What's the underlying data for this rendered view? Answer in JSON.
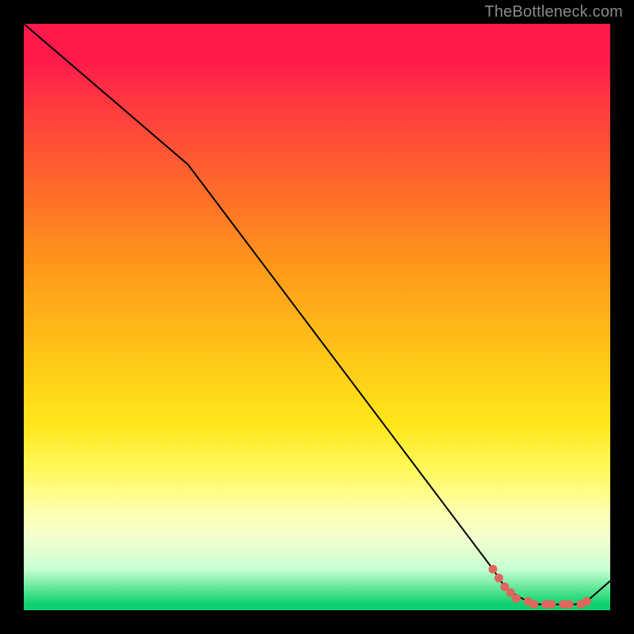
{
  "watermark": "TheBottleneck.com",
  "chart_data": {
    "type": "line",
    "title": "",
    "xlabel": "",
    "ylabel": "",
    "xlim": [
      0,
      100
    ],
    "ylim": [
      0,
      100
    ],
    "grid": false,
    "legend": false,
    "gradient_stops": [
      {
        "pct": 0,
        "color": "#ff1a4b"
      },
      {
        "pct": 6,
        "color": "#ff1a4b"
      },
      {
        "pct": 14,
        "color": "#ff3a3f"
      },
      {
        "pct": 28,
        "color": "#ff6a2a"
      },
      {
        "pct": 42,
        "color": "#ff9a1a"
      },
      {
        "pct": 56,
        "color": "#ffc418"
      },
      {
        "pct": 68,
        "color": "#ffe61a"
      },
      {
        "pct": 76,
        "color": "#fff95a"
      },
      {
        "pct": 83,
        "color": "#fdffad"
      },
      {
        "pct": 88,
        "color": "#f1ffd0"
      },
      {
        "pct": 93,
        "color": "#c8ffd4"
      },
      {
        "pct": 97,
        "color": "#49e28a"
      },
      {
        "pct": 99,
        "color": "#0fd071"
      },
      {
        "pct": 100,
        "color": "#0fd071"
      }
    ],
    "series": [
      {
        "name": "bottleneck-curve",
        "color": "#000000",
        "x": [
          0,
          28,
          80,
          82,
          84,
          86,
          88,
          90,
          92,
          94,
          96,
          100
        ],
        "y": [
          100,
          76,
          7,
          4,
          2.5,
          1.5,
          1,
          1,
          1,
          1,
          1.5,
          5
        ]
      }
    ],
    "markers": {
      "name": "highlight-dots",
      "color": "#e0675c",
      "points": [
        {
          "x": 80,
          "y": 7
        },
        {
          "x": 81,
          "y": 5.5
        },
        {
          "x": 82,
          "y": 4
        },
        {
          "x": 83,
          "y": 3
        },
        {
          "x": 84,
          "y": 2
        },
        {
          "x": 86,
          "y": 1.5
        },
        {
          "x": 87,
          "y": 1
        },
        {
          "x": 89,
          "y": 1
        },
        {
          "x": 90,
          "y": 1
        },
        {
          "x": 92,
          "y": 1
        },
        {
          "x": 93,
          "y": 1
        },
        {
          "x": 95,
          "y": 1
        },
        {
          "x": 96,
          "y": 1.5
        }
      ]
    }
  }
}
